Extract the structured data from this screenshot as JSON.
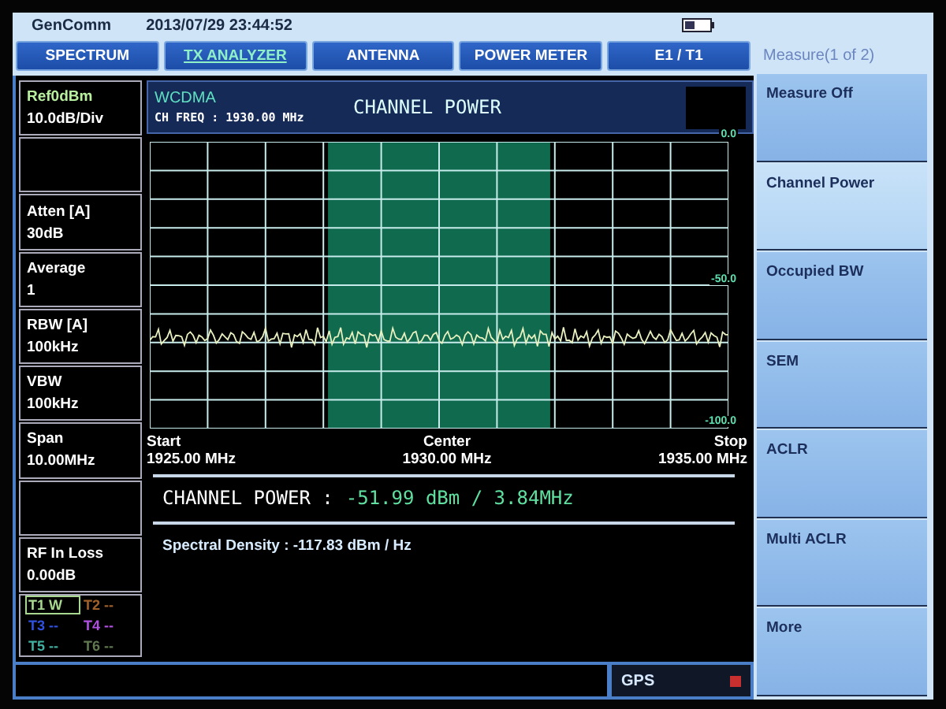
{
  "top_bar": {
    "brand": "GenComm",
    "datetime": "2013/07/29 23:44:52"
  },
  "tabs": [
    {
      "label": "SPECTRUM",
      "selected": false
    },
    {
      "label": "TX ANALYZER",
      "selected": true
    },
    {
      "label": "ANTENNA",
      "selected": false
    },
    {
      "label": "POWER METER",
      "selected": false
    },
    {
      "label": "E1 / T1",
      "selected": false
    }
  ],
  "params": [
    {
      "kind": "param",
      "label": "Ref0dBm",
      "value": "10.0dB/Div",
      "highlight": true
    },
    {
      "kind": "empty"
    },
    {
      "kind": "param",
      "label": "Atten [A]",
      "value": "30dB",
      "highlight": false
    },
    {
      "kind": "param",
      "label": "Average",
      "value": "1",
      "highlight": false
    },
    {
      "kind": "param",
      "label": "RBW [A]",
      "value": "100kHz",
      "highlight": false
    },
    {
      "kind": "param",
      "label": "VBW",
      "value": "100kHz",
      "highlight": false
    },
    {
      "kind": "param",
      "label": "Span",
      "value": "10.00MHz",
      "highlight": false
    },
    {
      "kind": "empty"
    },
    {
      "kind": "param",
      "label": "RF In Loss",
      "value": "0.00dB",
      "highlight": false
    }
  ],
  "traces": [
    {
      "label": "T1",
      "mode": "W",
      "color": "#a8d890",
      "selected": true
    },
    {
      "label": "T2",
      "mode": "--",
      "color": "#a0602a",
      "selected": false
    },
    {
      "label": "T3",
      "mode": "--",
      "color": "#3050e0",
      "selected": false
    },
    {
      "label": "T4",
      "mode": "--",
      "color": "#b050e0",
      "selected": false
    },
    {
      "label": "T5",
      "mode": "--",
      "color": "#40b0a0",
      "selected": false
    },
    {
      "label": "T6",
      "mode": "--",
      "color": "#607850",
      "selected": false
    }
  ],
  "display": {
    "standard": "WCDMA",
    "ch_freq": "CH FREQ : 1930.00 MHz",
    "title": "CHANNEL POWER",
    "y_labels": [
      "0.0",
      "-50.0",
      "-100.0"
    ],
    "x_labels": [
      {
        "name": "Start",
        "value": "1925.00 MHz"
      },
      {
        "name": "Center",
        "value": "1930.00 MHz"
      },
      {
        "name": "Stop",
        "value": "1935.00 MHz"
      }
    ]
  },
  "result": {
    "label": "CHANNEL POWER :",
    "value": "-51.99 dBm / 3.84MHz",
    "density": "Spectral Density : -117.83 dBm / Hz"
  },
  "status_bar": {
    "gps": "GPS",
    "gps_on": false
  },
  "menu": {
    "title": "Measure(1 of 2)",
    "items": [
      {
        "label": "Measure Off",
        "selected": false
      },
      {
        "label": "Channel Power",
        "selected": true
      },
      {
        "label": "Occupied BW",
        "selected": false
      },
      {
        "label": "SEM",
        "selected": false
      },
      {
        "label": "ACLR",
        "selected": false
      },
      {
        "label": "Multi ACLR",
        "selected": false
      },
      {
        "label": "More",
        "selected": false
      }
    ]
  }
}
